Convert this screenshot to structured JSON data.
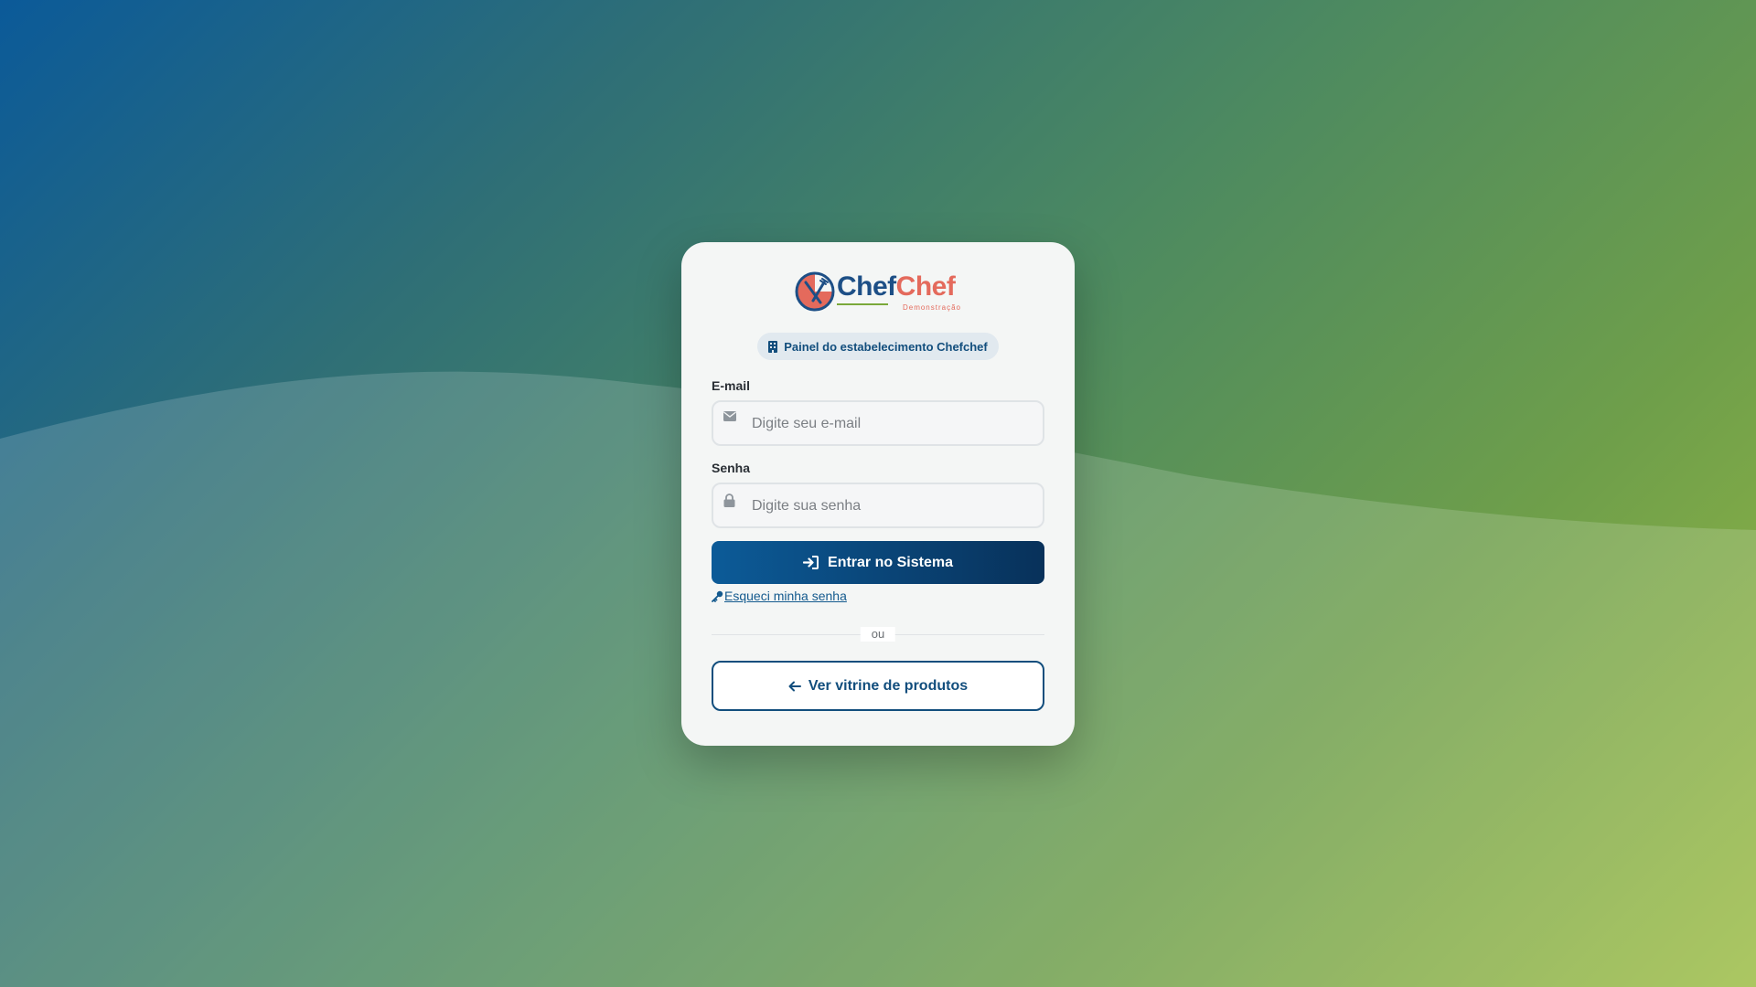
{
  "brand": {
    "name_part1": "Chef",
    "name_part2": "Chef",
    "subtitle": "Demonstração",
    "logo_icon": "chef-logo-icon"
  },
  "badge": {
    "icon": "building-icon",
    "label": "Painel do estabelecimento Chefchef"
  },
  "form": {
    "email": {
      "label": "E-mail",
      "placeholder": "Digite seu e-mail",
      "value": "",
      "icon": "envelope-icon"
    },
    "password": {
      "label": "Senha",
      "placeholder": "Digite sua senha",
      "value": "",
      "icon": "lock-icon"
    },
    "submit": {
      "label": "Entrar no Sistema",
      "icon": "sign-in-icon"
    },
    "forgot": {
      "label": "Esqueci minha senha",
      "icon": "key-icon"
    }
  },
  "divider": {
    "label": "ou"
  },
  "secondary_action": {
    "label": "Ver vitrine de produtos",
    "icon": "arrow-left-icon"
  },
  "colors": {
    "primary": "#0c5b98",
    "primary_dark": "#08315a",
    "brand_blue": "#1d4f86",
    "brand_coral": "#e46a5c",
    "brand_green": "#7aa83a"
  }
}
